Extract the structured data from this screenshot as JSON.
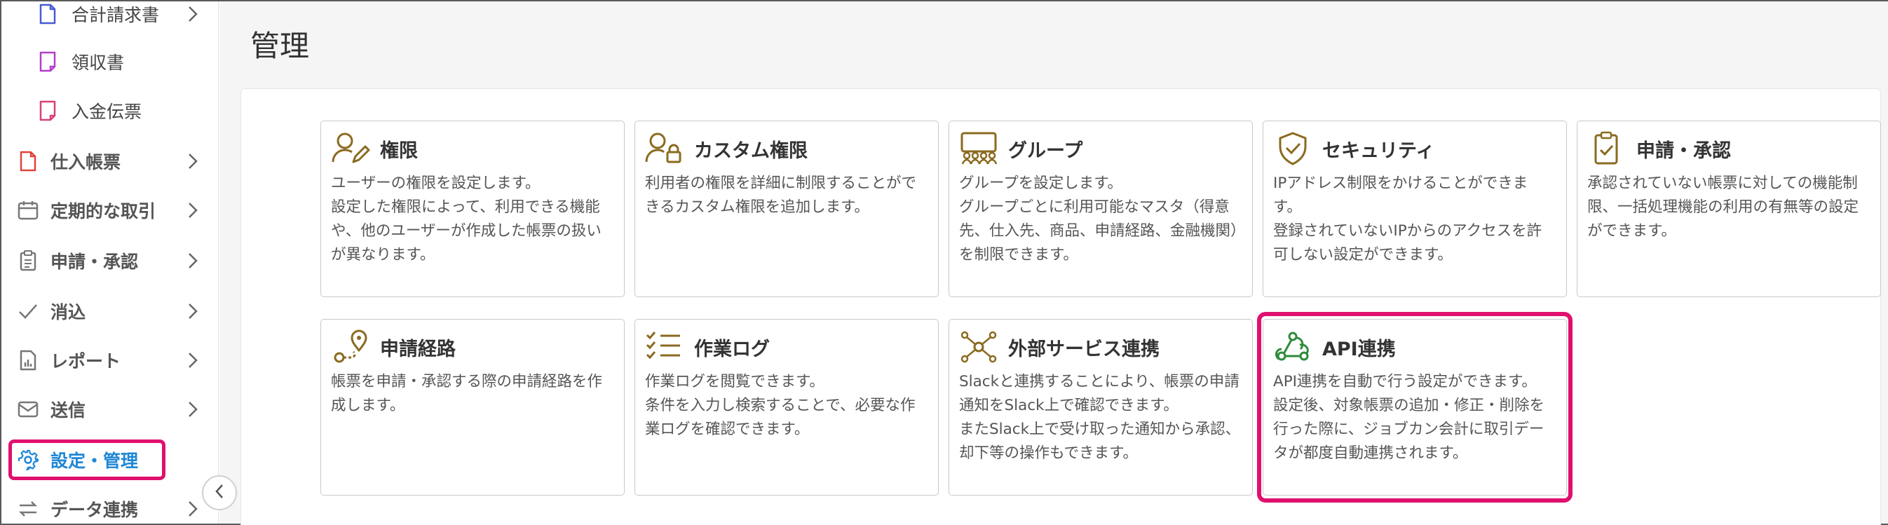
{
  "sidebar": {
    "items": [
      {
        "label": "合計請求書",
        "icon": "invoice-icon",
        "sub": true,
        "chevron": true
      },
      {
        "label": "領収書",
        "icon": "receipt-icon",
        "sub": true,
        "chevron": false
      },
      {
        "label": "入金伝票",
        "icon": "deposit-slip-icon",
        "sub": true,
        "chevron": false
      },
      {
        "label": "仕入帳票",
        "icon": "purchase-doc-icon",
        "sub": false,
        "chevron": true
      },
      {
        "label": "定期的な取引",
        "icon": "calendar-icon",
        "sub": false,
        "chevron": true
      },
      {
        "label": "申請・承認",
        "icon": "clipboard-list-icon",
        "sub": false,
        "chevron": true
      },
      {
        "label": "消込",
        "icon": "check-icon",
        "sub": false,
        "chevron": true
      },
      {
        "label": "レポート",
        "icon": "report-icon",
        "sub": false,
        "chevron": true
      },
      {
        "label": "送信",
        "icon": "mail-icon",
        "sub": false,
        "chevron": true
      },
      {
        "label": "設定・管理",
        "icon": "gear-icon",
        "sub": false,
        "chevron": false,
        "active": true
      },
      {
        "label": "データ連携",
        "icon": "sync-arrows-icon",
        "sub": false,
        "chevron": true
      }
    ]
  },
  "main": {
    "title": "管理",
    "cards": [
      {
        "title": "権限",
        "icon": "user-edit-icon",
        "desc": [
          "ユーザーの権限を設定します。",
          "設定した権限によって、利用できる機能や、他のユーザーが作成した帳票の扱いが異なります。"
        ]
      },
      {
        "title": "カスタム権限",
        "icon": "user-lock-icon",
        "desc": [
          "利用者の権限を詳細に制限することができるカスタム権限を追加します。"
        ]
      },
      {
        "title": "グループ",
        "icon": "group-icon",
        "desc": [
          "グループを設定します。",
          "グループごとに利用可能なマスタ（得意先、仕入先、商品、申請経路、金融機関）を制限できます。"
        ]
      },
      {
        "title": "セキュリティ",
        "icon": "shield-check-icon",
        "desc": [
          "IPアドレス制限をかけることができます。",
          "登録されていないIPからのアクセスを許可しない設定ができます。"
        ]
      },
      {
        "title": "申請・承認",
        "icon": "clipboard-check-icon",
        "desc": [
          "承認されていない帳票に対しての機能制限、一括処理機能の利用の有無等の設定ができます。"
        ]
      },
      {
        "title": "申請経路",
        "icon": "route-icon",
        "desc": [
          "帳票を申請・承認する際の申請経路を作成します。"
        ]
      },
      {
        "title": "作業ログ",
        "icon": "checklist-icon",
        "desc": [
          "作業ログを閲覧できます。",
          "条件を入力し検索することで、必要な作業ログを確認できます。"
        ]
      },
      {
        "title": "外部サービス連携",
        "icon": "network-icon",
        "desc": [
          "Slackと連携することにより、帳票の申請通知をSlack上で確認できます。",
          "またSlack上で受け取った通知から承認、却下等の操作もできます。"
        ]
      },
      {
        "title": "API連携",
        "icon": "webhook-icon",
        "desc": [
          "API連携を自動で行う設定ができます。",
          "設定後、対象帳票の追加・修正・削除を行った際に、ジョブカン会計に取引データが都度自動連携されます。"
        ]
      }
    ]
  },
  "colors": {
    "accent": "#1f87d6",
    "highlight": "#e0106e",
    "icon_gold": "#8a6a1f",
    "icon_green": "#2e8b3a"
  }
}
